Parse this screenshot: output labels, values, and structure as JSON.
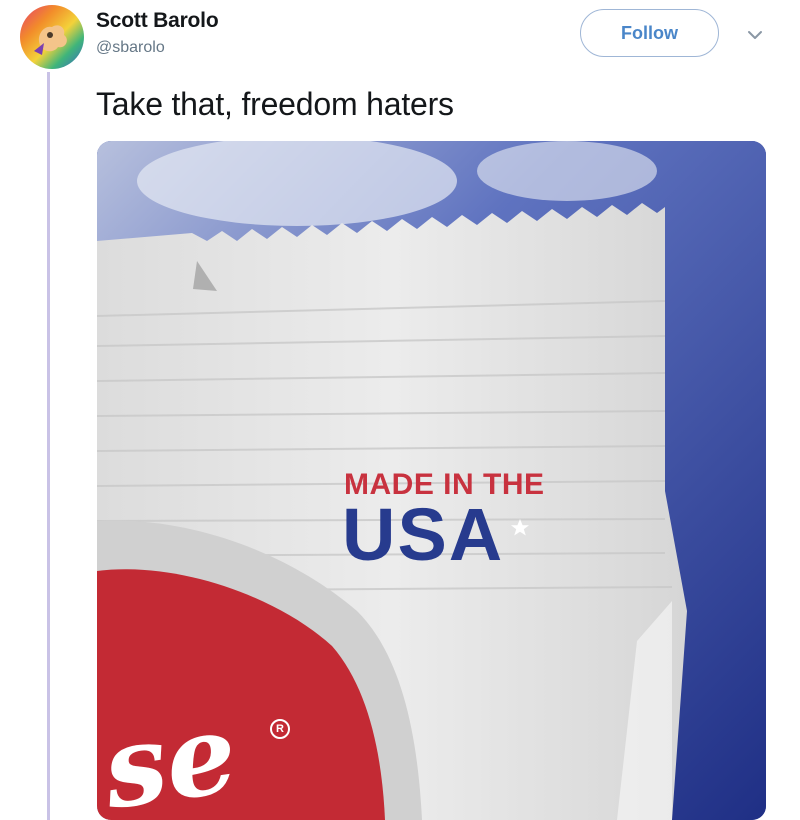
{
  "tweet": {
    "author": {
      "name": "Scott Barolo",
      "handle": "@sbarolo"
    },
    "follow_label": "Follow",
    "text": "Take that, freedom haters",
    "media": {
      "label_line1": "MADE IN THE",
      "label_line2": "USA",
      "brand_fragment": "se",
      "registered_mark": "R"
    }
  },
  "icons": {
    "avatar": "avatar-icon",
    "caret": "chevron-down-icon",
    "star": "star-icon"
  },
  "colors": {
    "follow_accent": "#4a86c9",
    "thread_line": "#c9c2e6",
    "label_red": "#c8323f",
    "label_blue": "#273b8e",
    "background_blue": "#2c3f9a"
  }
}
